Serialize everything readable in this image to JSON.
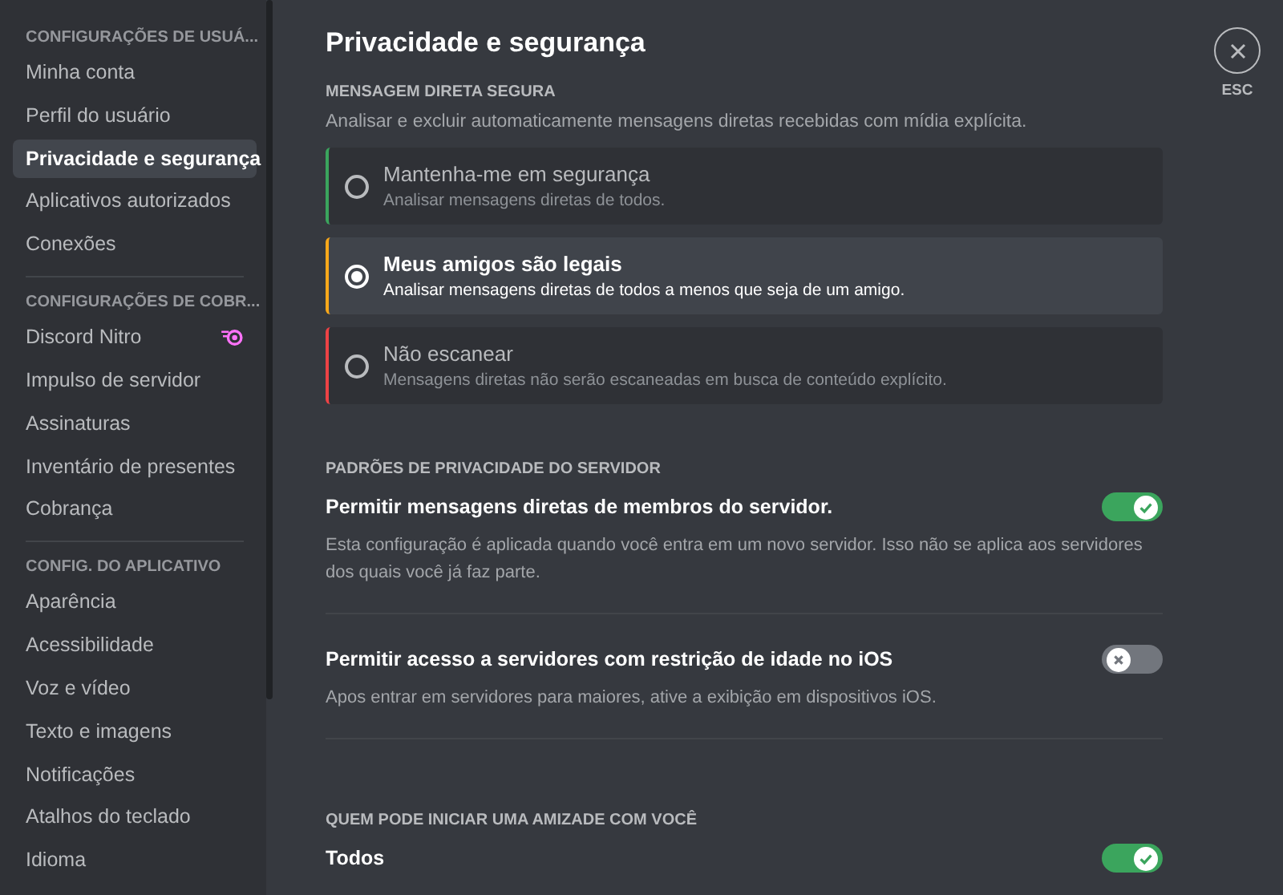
{
  "sidebar": {
    "sections": [
      {
        "header": "CONFIGURAÇÕES DE USUÁ...",
        "items": [
          {
            "label": "Minha conta",
            "selected": false
          },
          {
            "label": "Perfil do usuário",
            "selected": false
          },
          {
            "label": "Privacidade e segurança",
            "selected": true
          },
          {
            "label": "Aplicativos autorizados",
            "selected": false
          },
          {
            "label": "Conexões",
            "selected": false
          }
        ]
      },
      {
        "header": "CONFIGURAÇÕES DE COBR...",
        "items": [
          {
            "label": "Discord Nitro",
            "selected": false,
            "badge_icon": true
          },
          {
            "label": "Impulso de servidor",
            "selected": false
          },
          {
            "label": "Assinaturas",
            "selected": false
          },
          {
            "label": "Inventário de presentes",
            "selected": false
          },
          {
            "label": "Cobrança",
            "selected": false
          }
        ]
      },
      {
        "header": "CONFIG. DO APLICATIVO",
        "items": [
          {
            "label": "Aparência",
            "selected": false
          },
          {
            "label": "Acessibilidade",
            "selected": false
          },
          {
            "label": "Voz e vídeo",
            "selected": false
          },
          {
            "label": "Texto e imagens",
            "selected": false
          },
          {
            "label": "Notificações",
            "selected": false
          },
          {
            "label": "Atalhos do teclado",
            "selected": false
          },
          {
            "label": "Idioma",
            "selected": false
          }
        ]
      }
    ]
  },
  "title": "Privacidade e segurança",
  "close": {
    "label": "ESC"
  },
  "sections": [
    {
      "kind": "radio",
      "header": "MENSAGEM DIRETA SEGURA",
      "description": "Analisar e excluir automaticamente mensagens diretas recebidas com mídia explícita.",
      "options": [
        {
          "title": "Mantenha-me em segurança",
          "description": "Analisar mensagens diretas de todos.",
          "selected": false,
          "color": "#3ba55d"
        },
        {
          "title": "Meus amigos são legais",
          "description": "Analisar mensagens diretas de todos a menos que seja de um amigo.",
          "selected": true,
          "color": "#faa81a"
        },
        {
          "title": "Não escanear",
          "description": "Mensagens diretas não serão escaneadas em busca de conteúdo explícito.",
          "selected": false,
          "color": "#ed4245"
        }
      ]
    },
    {
      "kind": "toggles",
      "header": "PADRÕES DE PRIVACIDADE DO SERVIDOR",
      "toggles": [
        {
          "label": "Permitir mensagens diretas de membros do servidor.",
          "description": "Esta configuração é aplicada quando você entra em um novo servidor. Isso não se aplica aos servidores dos quais você já faz parte.",
          "on": true
        },
        {
          "label": "Permitir acesso a servidores com restrição de idade no iOS",
          "description": "Apos entrar em servidores para maiores, ative a exibição em dispositivos iOS.",
          "on": false
        }
      ]
    },
    {
      "kind": "toggles",
      "header": "QUEM PODE INICIAR UMA AMIZADE COM VOCÊ",
      "toggles": [
        {
          "label": "Todos",
          "on": true
        }
      ]
    }
  ]
}
